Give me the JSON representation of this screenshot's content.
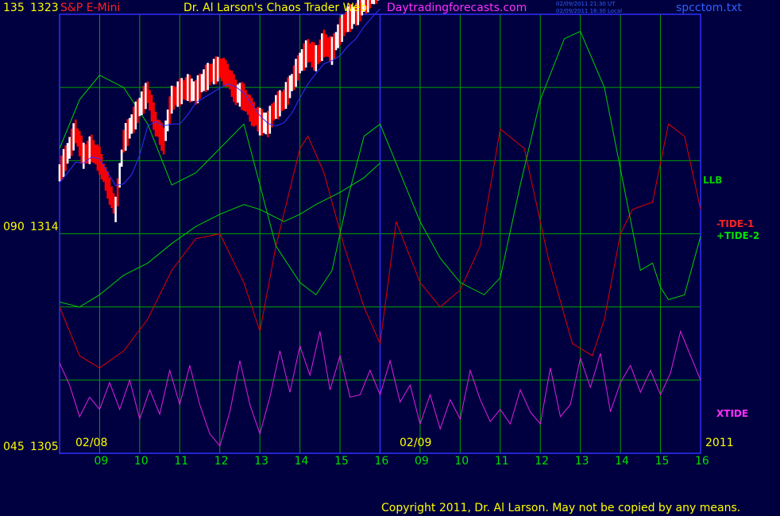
{
  "header": {
    "symbol": "S&P E-Mini",
    "author_title": "Dr. Al Larson's Chaos Trader Web",
    "site": "Daytradingforecasts.com",
    "timestamp_ut": "02/09/2011 21:30 UT",
    "timestamp_local": "02/09/2011 16:30 Local",
    "filename": "spcctom.txt"
  },
  "footer": {
    "copyright": "Copyright 2011, Dr. Al Larson. May not be copied by any means."
  },
  "y_axis_labels": [
    {
      "left": "135",
      "right": "1323",
      "value": 1323
    },
    {
      "left": "090",
      "right": "1314",
      "value": 1314
    },
    {
      "left": "045",
      "right": "1305",
      "value": 1305
    }
  ],
  "date_labels": {
    "day1": "02/08",
    "day2": "02/09",
    "year": "2011"
  },
  "x_hour_labels": [
    "09",
    "10",
    "11",
    "12",
    "13",
    "14",
    "15",
    "16",
    "09",
    "10",
    "11",
    "12",
    "13",
    "14",
    "15",
    "16"
  ],
  "series_labels": {
    "llb": "LLB",
    "tide1": "-TIDE-1",
    "tide2": "+TIDE-2",
    "xtide": "XTIDE"
  },
  "colors": {
    "background": "#000040",
    "grid": "#00A000",
    "axis": "#3030FF",
    "price_up": "#FFFFFF",
    "price_down": "#FF0000",
    "tide1": "#E00000",
    "tide2": "#00D000",
    "xtide": "#E020E0",
    "hour_label": "#00E000",
    "tick_label": "#FFFF00",
    "symbol": "#FF2020",
    "site": "#FF30FF",
    "filename": "#3060FF"
  },
  "chart_data": {
    "type": "line",
    "title": "S&P E-Mini",
    "x_type": "time",
    "x_range": [
      0,
      16
    ],
    "x_unit": "trading hours from 08:30 on 02/08 (16 = 02/09 16:00, end of window)",
    "ylim": [
      1305,
      1323
    ],
    "now_marker_x": 8,
    "series": [
      {
        "name": "-TIDE-1",
        "x": [
          0,
          0.5,
          1,
          1.6,
          2.2,
          2.8,
          3.4,
          4,
          4.6,
          5,
          5.4,
          6,
          6.2,
          6.6,
          7.1,
          7.6,
          8,
          8.4,
          9,
          9.5,
          10,
          10.5,
          11,
          11.6,
          12.2,
          12.8,
          13.3,
          13.6,
          14,
          14.3,
          14.8,
          15.2,
          15.6,
          16
        ],
        "values": [
          1311.0,
          1309.0,
          1308.5,
          1309.2,
          1310.5,
          1312.5,
          1313.8,
          1314.0,
          1312.0,
          1310.0,
          1313.5,
          1317.5,
          1318.0,
          1316.5,
          1313.5,
          1311.0,
          1309.5,
          1314.5,
          1312.0,
          1311.0,
          1311.7,
          1313.5,
          1318.3,
          1317.5,
          1313.0,
          1309.5,
          1309.0,
          1310.5,
          1314.0,
          1315.0,
          1315.3,
          1318.5,
          1318.0,
          1315.0
        ]
      },
      {
        "name": "+TIDE-2",
        "x": [
          0,
          0.5,
          1,
          1.6,
          2.2,
          2.8,
          3.4,
          4,
          4.6,
          5,
          5.4,
          6,
          6.4,
          6.8,
          7.2,
          7.6,
          8,
          8.5,
          9,
          9.5,
          10,
          10.6,
          11,
          11.5,
          12,
          12.6,
          13,
          13.6,
          14.2,
          14.5,
          14.8,
          15,
          15.2,
          15.6,
          16
        ],
        "values": [
          1317.5,
          1319.5,
          1320.5,
          1320.0,
          1318.5,
          1316.0,
          1316.5,
          1317.5,
          1318.5,
          1316.0,
          1313.5,
          1312.0,
          1311.5,
          1312.5,
          1315.5,
          1318.0,
          1318.5,
          1316.5,
          1314.5,
          1313.0,
          1312.0,
          1311.5,
          1312.2,
          1316.0,
          1319.5,
          1322.0,
          1322.3,
          1320.0,
          1315.0,
          1312.5,
          1312.8,
          1311.8,
          1311.3,
          1311.5,
          1313.9
        ]
      },
      {
        "name": "LLB",
        "x": [
          0,
          0.5,
          1,
          1.6,
          2.2,
          2.8,
          3.4,
          4,
          4.6,
          5,
          5.6,
          6,
          6.4,
          7,
          7.6,
          8
        ],
        "values": [
          1311.2,
          1311.0,
          1311.5,
          1312.3,
          1312.8,
          1313.6,
          1314.3,
          1314.8,
          1315.2,
          1315.0,
          1314.5,
          1314.8,
          1315.2,
          1315.7,
          1316.3,
          1316.9
        ]
      },
      {
        "name": "Price",
        "x": [
          0,
          0.2,
          0.4,
          0.6,
          0.8,
          1,
          1.2,
          1.4,
          1.6,
          1.8,
          2,
          2.2,
          2.4,
          2.6,
          2.8,
          3,
          3.2,
          3.4,
          3.6,
          3.8,
          4,
          4.2,
          4.4,
          4.6,
          4.8,
          5,
          5.2,
          5.4,
          5.6,
          5.8,
          6,
          6.2,
          6.4,
          6.6,
          6.8,
          7,
          7.2,
          7.4,
          7.6,
          7.8,
          8
        ],
        "values": [
          1316.5,
          1317.3,
          1318.2,
          1317.2,
          1317.5,
          1317.0,
          1316.0,
          1315.0,
          1317.8,
          1318.5,
          1319.2,
          1319.8,
          1318.5,
          1317.8,
          1319.5,
          1319.8,
          1320.0,
          1319.8,
          1320.3,
          1320.6,
          1320.8,
          1320.5,
          1319.8,
          1319.6,
          1319.0,
          1318.6,
          1318.5,
          1319.2,
          1319.5,
          1320.2,
          1321.0,
          1321.5,
          1321.2,
          1321.8,
          1321.5,
          1322.3,
          1322.8,
          1323.0,
          1323.5,
          1323.8,
          1324.2
        ]
      },
      {
        "name": "XTIDE",
        "x": [
          0,
          0.25,
          0.5,
          0.75,
          1,
          1.25,
          1.5,
          1.75,
          2,
          2.25,
          2.5,
          2.75,
          3,
          3.25,
          3.5,
          3.75,
          4,
          4.25,
          4.5,
          4.75,
          5,
          5.25,
          5.5,
          5.75,
          6,
          6.25,
          6.5,
          6.75,
          7,
          7.25,
          7.5,
          7.75,
          8,
          8.25,
          8.5,
          8.75,
          9,
          9.25,
          9.5,
          9.75,
          10,
          10.25,
          10.5,
          10.75,
          11,
          11.25,
          11.5,
          11.75,
          12,
          12.25,
          12.5,
          12.75,
          13,
          13.25,
          13.5,
          13.75,
          14,
          14.25,
          14.5,
          14.75,
          15,
          15.25,
          15.5,
          15.75,
          16
        ],
        "values": [
          1308.7,
          1307.8,
          1306.5,
          1307.3,
          1306.8,
          1307.9,
          1306.8,
          1308.0,
          1306.4,
          1307.6,
          1306.6,
          1308.4,
          1307.0,
          1308.6,
          1307.0,
          1305.8,
          1305.3,
          1306.7,
          1308.8,
          1307.0,
          1305.8,
          1307.3,
          1309.2,
          1307.5,
          1309.4,
          1308.2,
          1310.0,
          1307.6,
          1309.0,
          1307.3,
          1307.4,
          1308.4,
          1307.4,
          1308.8,
          1307.1,
          1307.8,
          1306.2,
          1307.4,
          1306.0,
          1307.2,
          1306.4,
          1308.4,
          1307.2,
          1306.3,
          1306.8,
          1306.2,
          1307.6,
          1306.7,
          1306.2,
          1308.5,
          1306.5,
          1307.0,
          1308.9,
          1307.7,
          1309.1,
          1306.7,
          1307.9,
          1308.6,
          1307.5,
          1308.4,
          1307.4,
          1308.3,
          1310.0,
          1309.0,
          1308.0
        ]
      }
    ],
    "annotations": [
      "LLB",
      "-TIDE-1",
      "+TIDE-2",
      "XTIDE"
    ]
  }
}
